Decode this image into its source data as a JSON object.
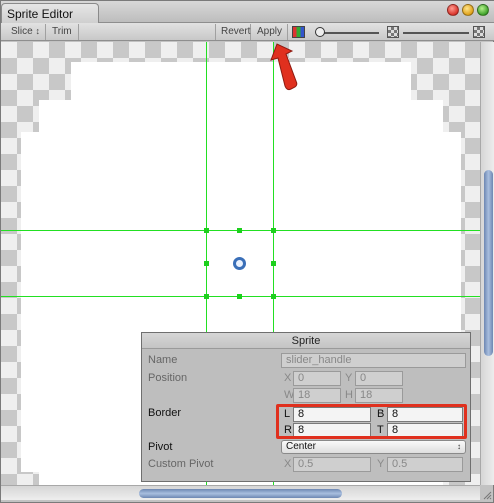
{
  "window": {
    "tab_title": "Sprite Editor",
    "accent": "#22e022",
    "annotation_color": "#e0301e"
  },
  "toolbar": {
    "slice_label": "Slice",
    "slice_arrow": "↕",
    "trim_label": "Trim",
    "revert_label": "Revert",
    "apply_label": "Apply",
    "color_channel_icon": "rgb-channel-icon",
    "alpha_icon": "checker-alpha-icon",
    "mip_icon": "checker-mip-icon"
  },
  "panel": {
    "title": "Sprite",
    "name_label": "Name",
    "name_value": "slider_handle",
    "position_label": "Position",
    "x_label": "X",
    "x_value": "0",
    "y_label": "Y",
    "y_value": "0",
    "w_label": "W",
    "w_value": "18",
    "h_label": "H",
    "h_value": "18",
    "border_label": "Border",
    "l_label": "L",
    "l_value": "8",
    "b_label": "B",
    "b_value": "8",
    "r_label": "R",
    "r_value": "8",
    "t_label": "T",
    "t_value": "8",
    "pivot_label": "Pivot",
    "pivot_value": "Center",
    "custom_pivot_label": "Custom Pivot",
    "cp_x_label": "X",
    "cp_x_value": "0.5",
    "cp_y_label": "Y",
    "cp_y_value": "0.5"
  }
}
